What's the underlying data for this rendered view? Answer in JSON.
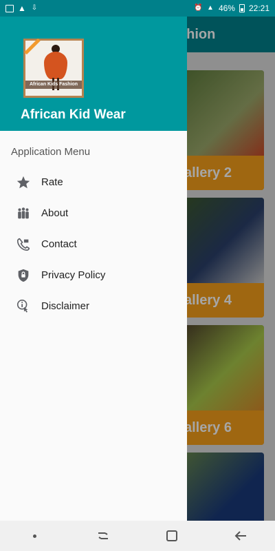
{
  "status_bar": {
    "battery": "46%",
    "time": "22:21"
  },
  "background_app": {
    "title_fragment": "shion",
    "cards": [
      {
        "caption": "allery 2"
      },
      {
        "caption": "allery 4"
      },
      {
        "caption": "allery 6"
      }
    ]
  },
  "drawer": {
    "logo_text": "African Kids Fashion",
    "app_name": "African Kid Wear",
    "section_title": "Application Menu",
    "items": [
      {
        "label": "Rate",
        "icon": "star-icon"
      },
      {
        "label": "About",
        "icon": "people-icon"
      },
      {
        "label": "Contact",
        "icon": "phone-icon"
      },
      {
        "label": "Privacy Policy",
        "icon": "lock-icon"
      },
      {
        "label": "Disclaimer",
        "icon": "info-touch-icon"
      }
    ]
  },
  "colors": {
    "primary": "#00989e",
    "accent": "#f59e1b"
  }
}
